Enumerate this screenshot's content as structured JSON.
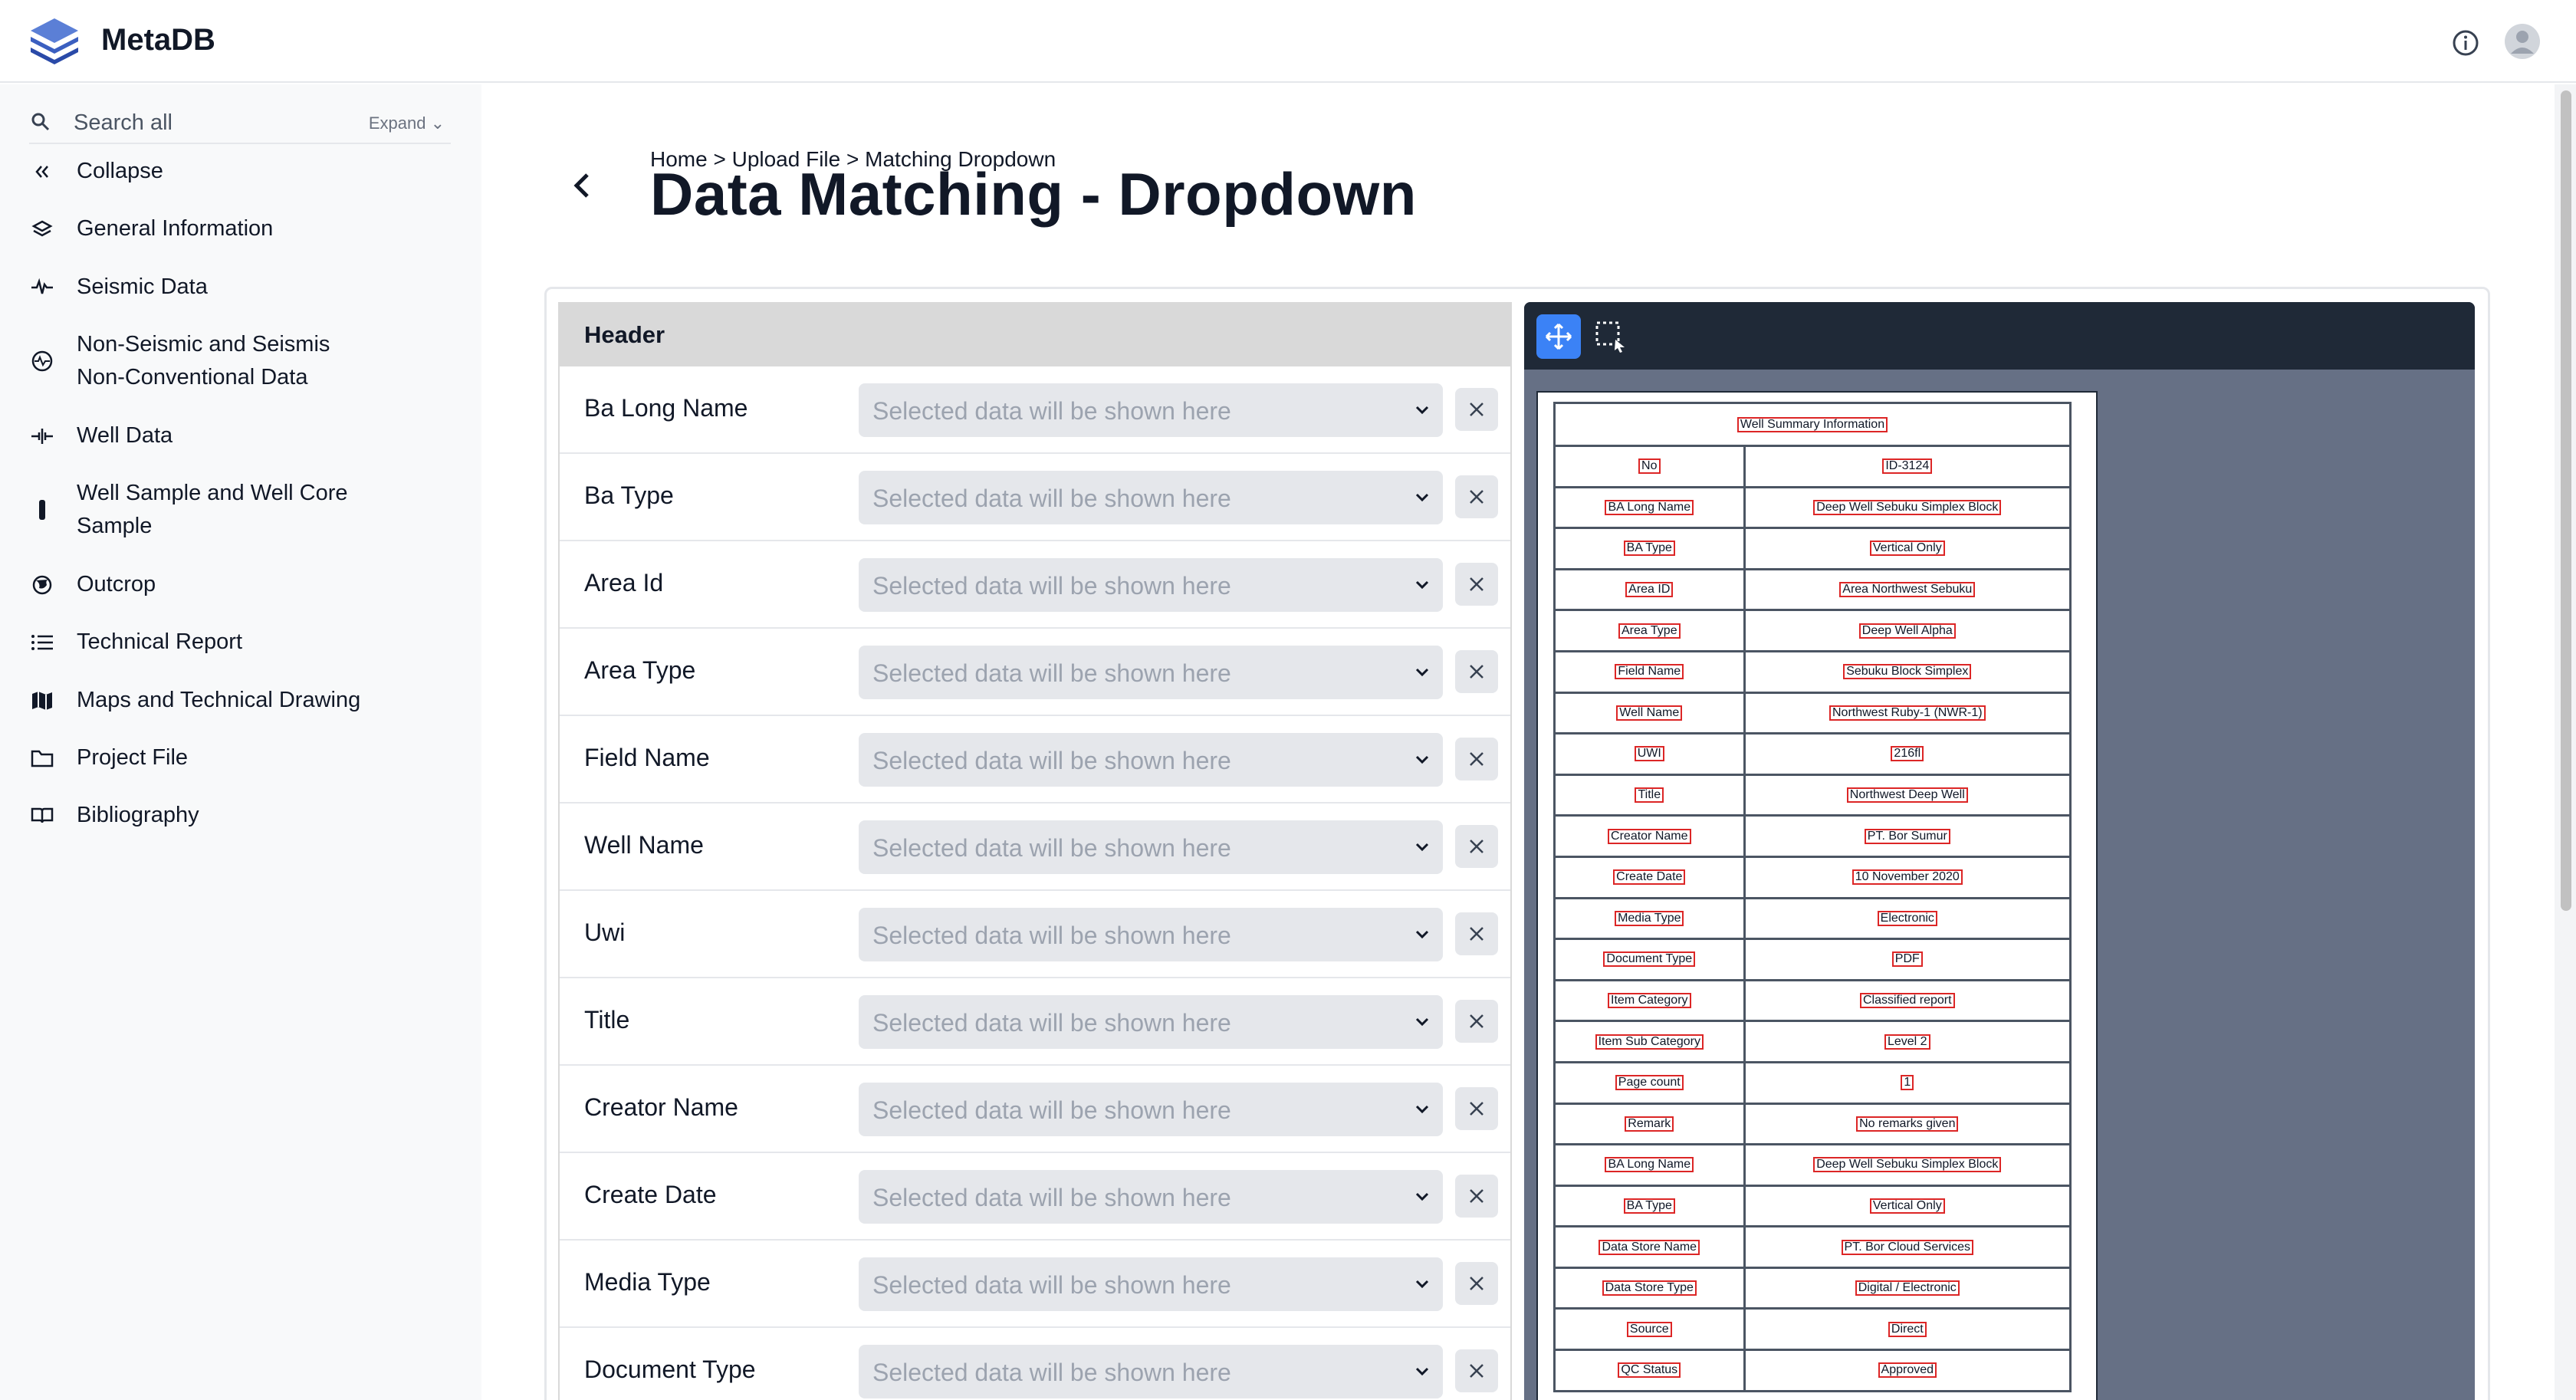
{
  "app": {
    "title": "MetaDB"
  },
  "sidebar": {
    "search_placeholder": "Search all",
    "expand_label": "Expand",
    "items": [
      {
        "label": "Collapse",
        "icon": "double-chevron-left-icon"
      },
      {
        "label": "General Information",
        "icon": "layers-icon"
      },
      {
        "label": "Seismic Data",
        "icon": "waveform-icon"
      },
      {
        "label": "Non-Seismic and Seismis",
        "label2": "Non-Conventional Data",
        "icon": "radar-icon"
      },
      {
        "label": "Well Data",
        "icon": "well-signal-icon"
      },
      {
        "label": "Well Sample and Well Core",
        "label2": "Sample",
        "icon": "core-sample-icon"
      },
      {
        "label": "Outcrop",
        "icon": "globe-icon"
      },
      {
        "label": "Technical Report",
        "icon": "list-icon"
      },
      {
        "label": "Maps and Technical Drawing",
        "icon": "map-icon"
      },
      {
        "label": "Project File",
        "icon": "folder-icon"
      },
      {
        "label": "Bibliography",
        "icon": "open-book-icon"
      }
    ]
  },
  "main": {
    "breadcrumb": "Home > Upload File > Matching Dropdown",
    "title": "Data Matching - Dropdown",
    "form": {
      "header": "Header",
      "placeholder": "Selected data will be shown here",
      "fields": [
        "Ba Long Name",
        "Ba Type",
        "Area Id",
        "Area Type",
        "Field Name",
        "Well Name",
        "Uwi",
        "Title",
        "Creator Name",
        "Create Date",
        "Media Type",
        "Document Type"
      ]
    },
    "viewer": {
      "doc_title": "Well Summary Information",
      "rows": [
        [
          "No",
          "ID-3124"
        ],
        [
          "BA Long Name",
          "Deep Well Sebuku Simplex Block"
        ],
        [
          "BA Type",
          "Vertical Only"
        ],
        [
          "Area ID",
          "Area Northwest Sebuku"
        ],
        [
          "Area Type",
          "Deep Well Alpha"
        ],
        [
          "Field Name",
          "Sebuku Block Simplex"
        ],
        [
          "Well Name",
          "Northwest Ruby-1 (NWR-1)"
        ],
        [
          "UWI",
          "216fl"
        ],
        [
          "Title",
          "Northwest Deep Well"
        ],
        [
          "Creator Name",
          "PT. Bor Sumur"
        ],
        [
          "Create Date",
          "10 November 2020"
        ],
        [
          "Media Type",
          "Electronic"
        ],
        [
          "Document Type",
          "PDF"
        ],
        [
          "Item Category",
          "Classified report"
        ],
        [
          "Item Sub Category",
          "Level 2"
        ],
        [
          "Page count",
          "1"
        ],
        [
          "Remark",
          "No remarks given"
        ],
        [
          "BA Long Name",
          "Deep Well Sebuku Simplex Block"
        ],
        [
          "BA Type",
          "Vertical Only"
        ],
        [
          "Data Store Name",
          "PT. Bor Cloud Services"
        ],
        [
          "Data Store Type",
          "Digital / Electronic"
        ],
        [
          "Source",
          "Direct"
        ],
        [
          "QC Status",
          "Approved"
        ]
      ]
    }
  },
  "colors": {
    "accent": "#3b82f6",
    "viewer_bg": "#667085",
    "toolbar_bg": "#1f2937",
    "highlight": "#dc2626"
  }
}
